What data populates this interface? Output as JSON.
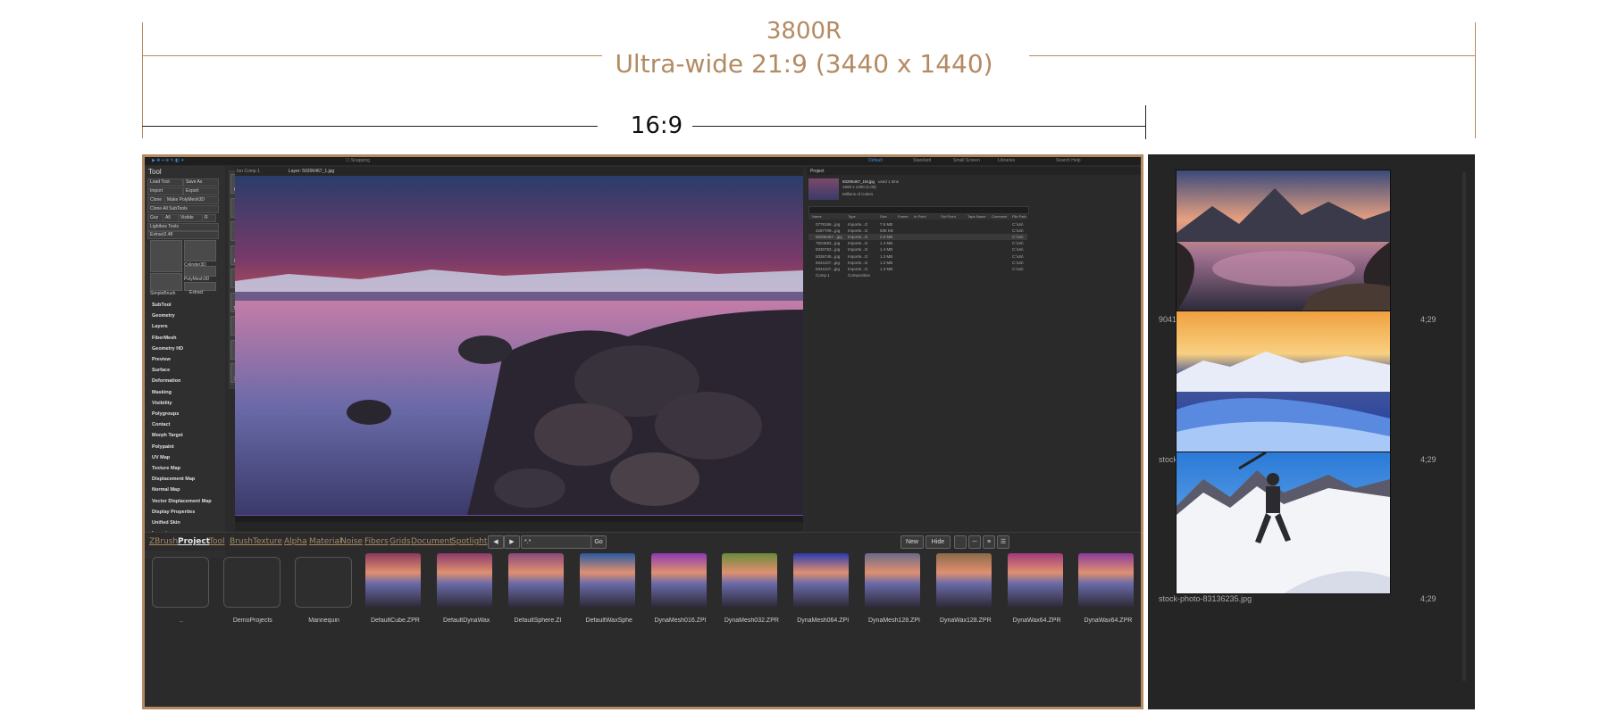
{
  "header": {
    "title_main": "3800R",
    "title_sub": "Ultra-wide 21:9 (3440 x 1440)",
    "inner_label": "16:9"
  },
  "app": {
    "tool_title": "Tool",
    "tool_buttons": [
      "Load Tool",
      "Save As",
      "Import",
      "Export",
      "Clone",
      "Make PolyMesh3D",
      "Clone All SubTools",
      "Goz",
      "All",
      "Visible",
      "R",
      "Lightbox Tools",
      "Extract2.48"
    ],
    "tool_thumbs": [
      "",
      "Cylinder3D",
      "SimpleBrush",
      "PolyMesh3D",
      "Extract"
    ],
    "tool_sections": [
      "SubTool",
      "Geometry",
      "Layers",
      "FiberMesh",
      "Geometry HD",
      "Preview",
      "Surface",
      "Deformation",
      "Masking",
      "Visibility",
      "Polygroups",
      "Contact",
      "Morph Target",
      "Polypaint",
      "UV Map",
      "Texture Map",
      "Displacement Map",
      "Normal Map",
      "Vector Displacement Map",
      "Display Properties",
      "Unified Skin",
      "Import",
      "Export"
    ],
    "vtools": [
      "Frame",
      "Move",
      "Scale",
      "Rotate",
      "PolyF",
      "Transp",
      "",
      "Solo",
      "Xpose"
    ],
    "viewer_tabs": [
      "Ion Comp 1",
      "Layer: 50206467_1.jpg"
    ],
    "project_panel": {
      "title": "Project",
      "file_name": "50206467_1M.jpg",
      "file_info": "used 1 time",
      "file_dims": "1600 x 1200 (1.00)",
      "colors": "Millions of Colors",
      "columns": [
        "Name",
        "Type",
        "Size",
        "Frame",
        "In Point",
        "Out Point",
        "Tape Name",
        "Comment",
        "File Path"
      ],
      "rows": [
        {
          "name": "0778196...jpg",
          "type": "Importe...G",
          "size": "7.5 MB",
          "path": "C:\\Us\\"
        },
        {
          "name": "4287709...jpg",
          "type": "Importe...G",
          "size": "939 KB",
          "path": "C:\\Us\\"
        },
        {
          "name": "50206467...jpg",
          "type": "Importe...G",
          "size": "2.6 MB",
          "path": "C:\\Us\\"
        },
        {
          "name": "7504683...jpg",
          "type": "Importe...G",
          "size": "1.4 MB",
          "path": "C:\\Us\\"
        },
        {
          "name": "8330783...jpg",
          "type": "Importe...G",
          "size": "1.4 MB",
          "path": "C:\\Us\\"
        },
        {
          "name": "8336745...jpg",
          "type": "Importe...G",
          "size": "1.3 MB",
          "path": "C:\\Us\\"
        },
        {
          "name": "9341107...jpg",
          "type": "Importe...G",
          "size": "1.3 MB",
          "path": "C:\\Us\\"
        },
        {
          "name": "9341107...jpg",
          "type": "Importe...G",
          "size": "1.3 MB",
          "path": "C:\\Us\\"
        },
        {
          "name": "Comp 1",
          "type": "Composition",
          "size": "",
          "path": ""
        }
      ]
    },
    "lightbox_tabs": [
      "ZBrush",
      "Project",
      "Tool",
      "Brush",
      "Texture",
      "Alpha",
      "Material",
      "Noise",
      "Fibers",
      "Grids",
      "Document",
      "Spotlight"
    ],
    "lightbox_active": "Project",
    "lightbox_search": "*.*",
    "lightbox_go": "Go",
    "lightbox_new": "New",
    "lightbox_hide": "Hide",
    "lightbox_items": [
      {
        "label": "..",
        "kind": "folder"
      },
      {
        "label": "DemoProjects",
        "kind": "folder"
      },
      {
        "label": "Mannequin",
        "kind": "folder"
      },
      {
        "label": "DefaultCube.ZPR",
        "kind": "image",
        "tint": "#8a3a5a"
      },
      {
        "label": "DefaultDynaWax",
        "kind": "image",
        "tint": "#8a3a6a"
      },
      {
        "label": "DefaultSphere.ZI",
        "kind": "image",
        "tint": "#8a4a7a"
      },
      {
        "label": "DefaultWaxSphe",
        "kind": "image",
        "tint": "#2a5aa0"
      },
      {
        "label": "DynaMesh016.ZPI",
        "kind": "image",
        "tint": "#8a3ab0"
      },
      {
        "label": "DynaMesh032.ZPR",
        "kind": "image",
        "tint": "#6a8a3a"
      },
      {
        "label": "DynaMesh064.ZPI",
        "kind": "image",
        "tint": "#2a3ab0"
      },
      {
        "label": "DynaMesh128.ZPI",
        "kind": "image",
        "tint": "#6a6a8a"
      },
      {
        "label": "DynaWax128.ZPR",
        "kind": "image",
        "tint": "#8a6a4a"
      },
      {
        "label": "DynaWax64.ZPR",
        "kind": "image",
        "tint": "#a03a7a"
      },
      {
        "label": "DynaWax64.ZPR",
        "kind": "image",
        "tint": "#8a3a9a"
      }
    ]
  },
  "right_screen": {
    "items": [
      {
        "label": "90411077_6M.jpg",
        "duration": "4;29"
      },
      {
        "label": "stock-photo-93180767.jpg",
        "duration": "4;29"
      },
      {
        "label": "stock-photo-83136235.jpg",
        "duration": "4;29"
      }
    ]
  },
  "colors": {
    "accent": "#b48a63",
    "panel": "#2b2b2b",
    "timeline_accent": "#6a4aa8"
  }
}
